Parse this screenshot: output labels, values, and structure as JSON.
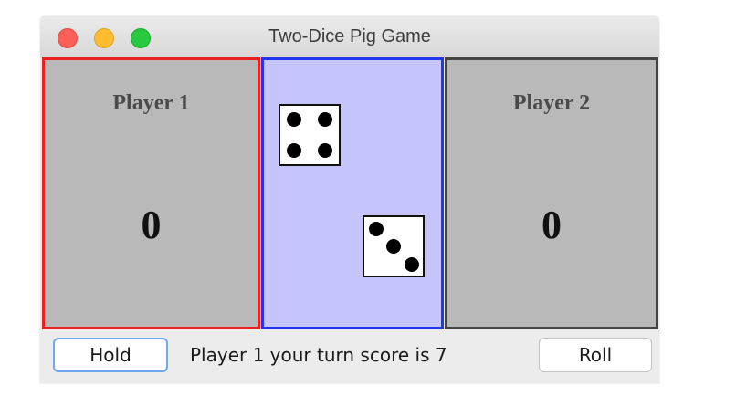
{
  "window": {
    "title": "Two-Dice Pig Game"
  },
  "players": [
    {
      "name": "Player 1",
      "score": "0",
      "border_color": "#f02020",
      "active": true
    },
    {
      "name": "Player 2",
      "score": "0",
      "border_color": "#434343",
      "active": false
    }
  ],
  "dice": {
    "background_color": "#c5c5fb",
    "border_color": "#1f36f0",
    "values": [
      4,
      3
    ]
  },
  "controls": {
    "hold_label": "Hold",
    "roll_label": "Roll",
    "status_text": "Player 1 your turn score is 7"
  },
  "colors": {
    "player_panel_bg": "#b9b9b9",
    "focus_ring": "#6ea8f0"
  }
}
